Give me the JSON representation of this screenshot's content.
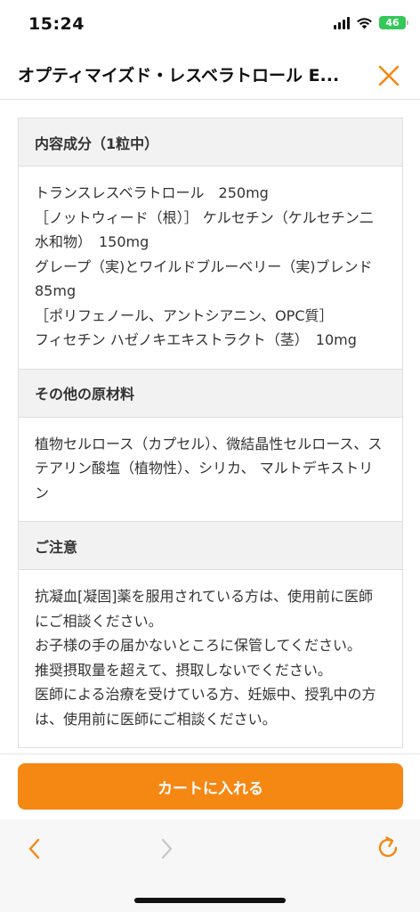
{
  "status": {
    "time": "15:24",
    "battery": "46"
  },
  "header": {
    "title": "オプティマイズド・レスベラトロール E..."
  },
  "sections": [
    {
      "title": "内容成分（1粒中）",
      "lines": [
        "トランスレスベラトロール　250mg",
        "［ノットウィード（根）］ ケルセチン（ケルセチン二水和物）　150mg",
        "グレープ（実)とワイルドブルーベリー（実)ブレンド　85mg",
        "［ポリフェノール、アントシアニン、OPC質］",
        "フィセチン ハゼノキエキストラクト（茎）　10mg"
      ]
    },
    {
      "title": "その他の原材料",
      "lines": [
        "植物セルロース（カプセル）、微結晶性セルロース、ステアリン酸塩（植物性）、シリカ、 マルトデキストリン"
      ]
    },
    {
      "title": "ご注意",
      "lines": [
        "抗凝血[凝固]薬を服用されている方は、使用前に医師にご相談ください。",
        "お子様の手の届かないところに保管してください。",
        "推奨摂取量を超えて、摂取しないでください。",
        "医師による治療を受けている方、妊娠中、授乳中の方は、使用前に医師にご相談ください。"
      ]
    }
  ],
  "footer": {
    "cart_label": "カートに入れる"
  },
  "colors": {
    "accent": "#f58713",
    "battery": "#34c759"
  },
  "icons": {
    "close": "close-icon",
    "back": "chevron-left-icon",
    "forward": "chevron-right-icon",
    "reload": "reload-icon"
  }
}
